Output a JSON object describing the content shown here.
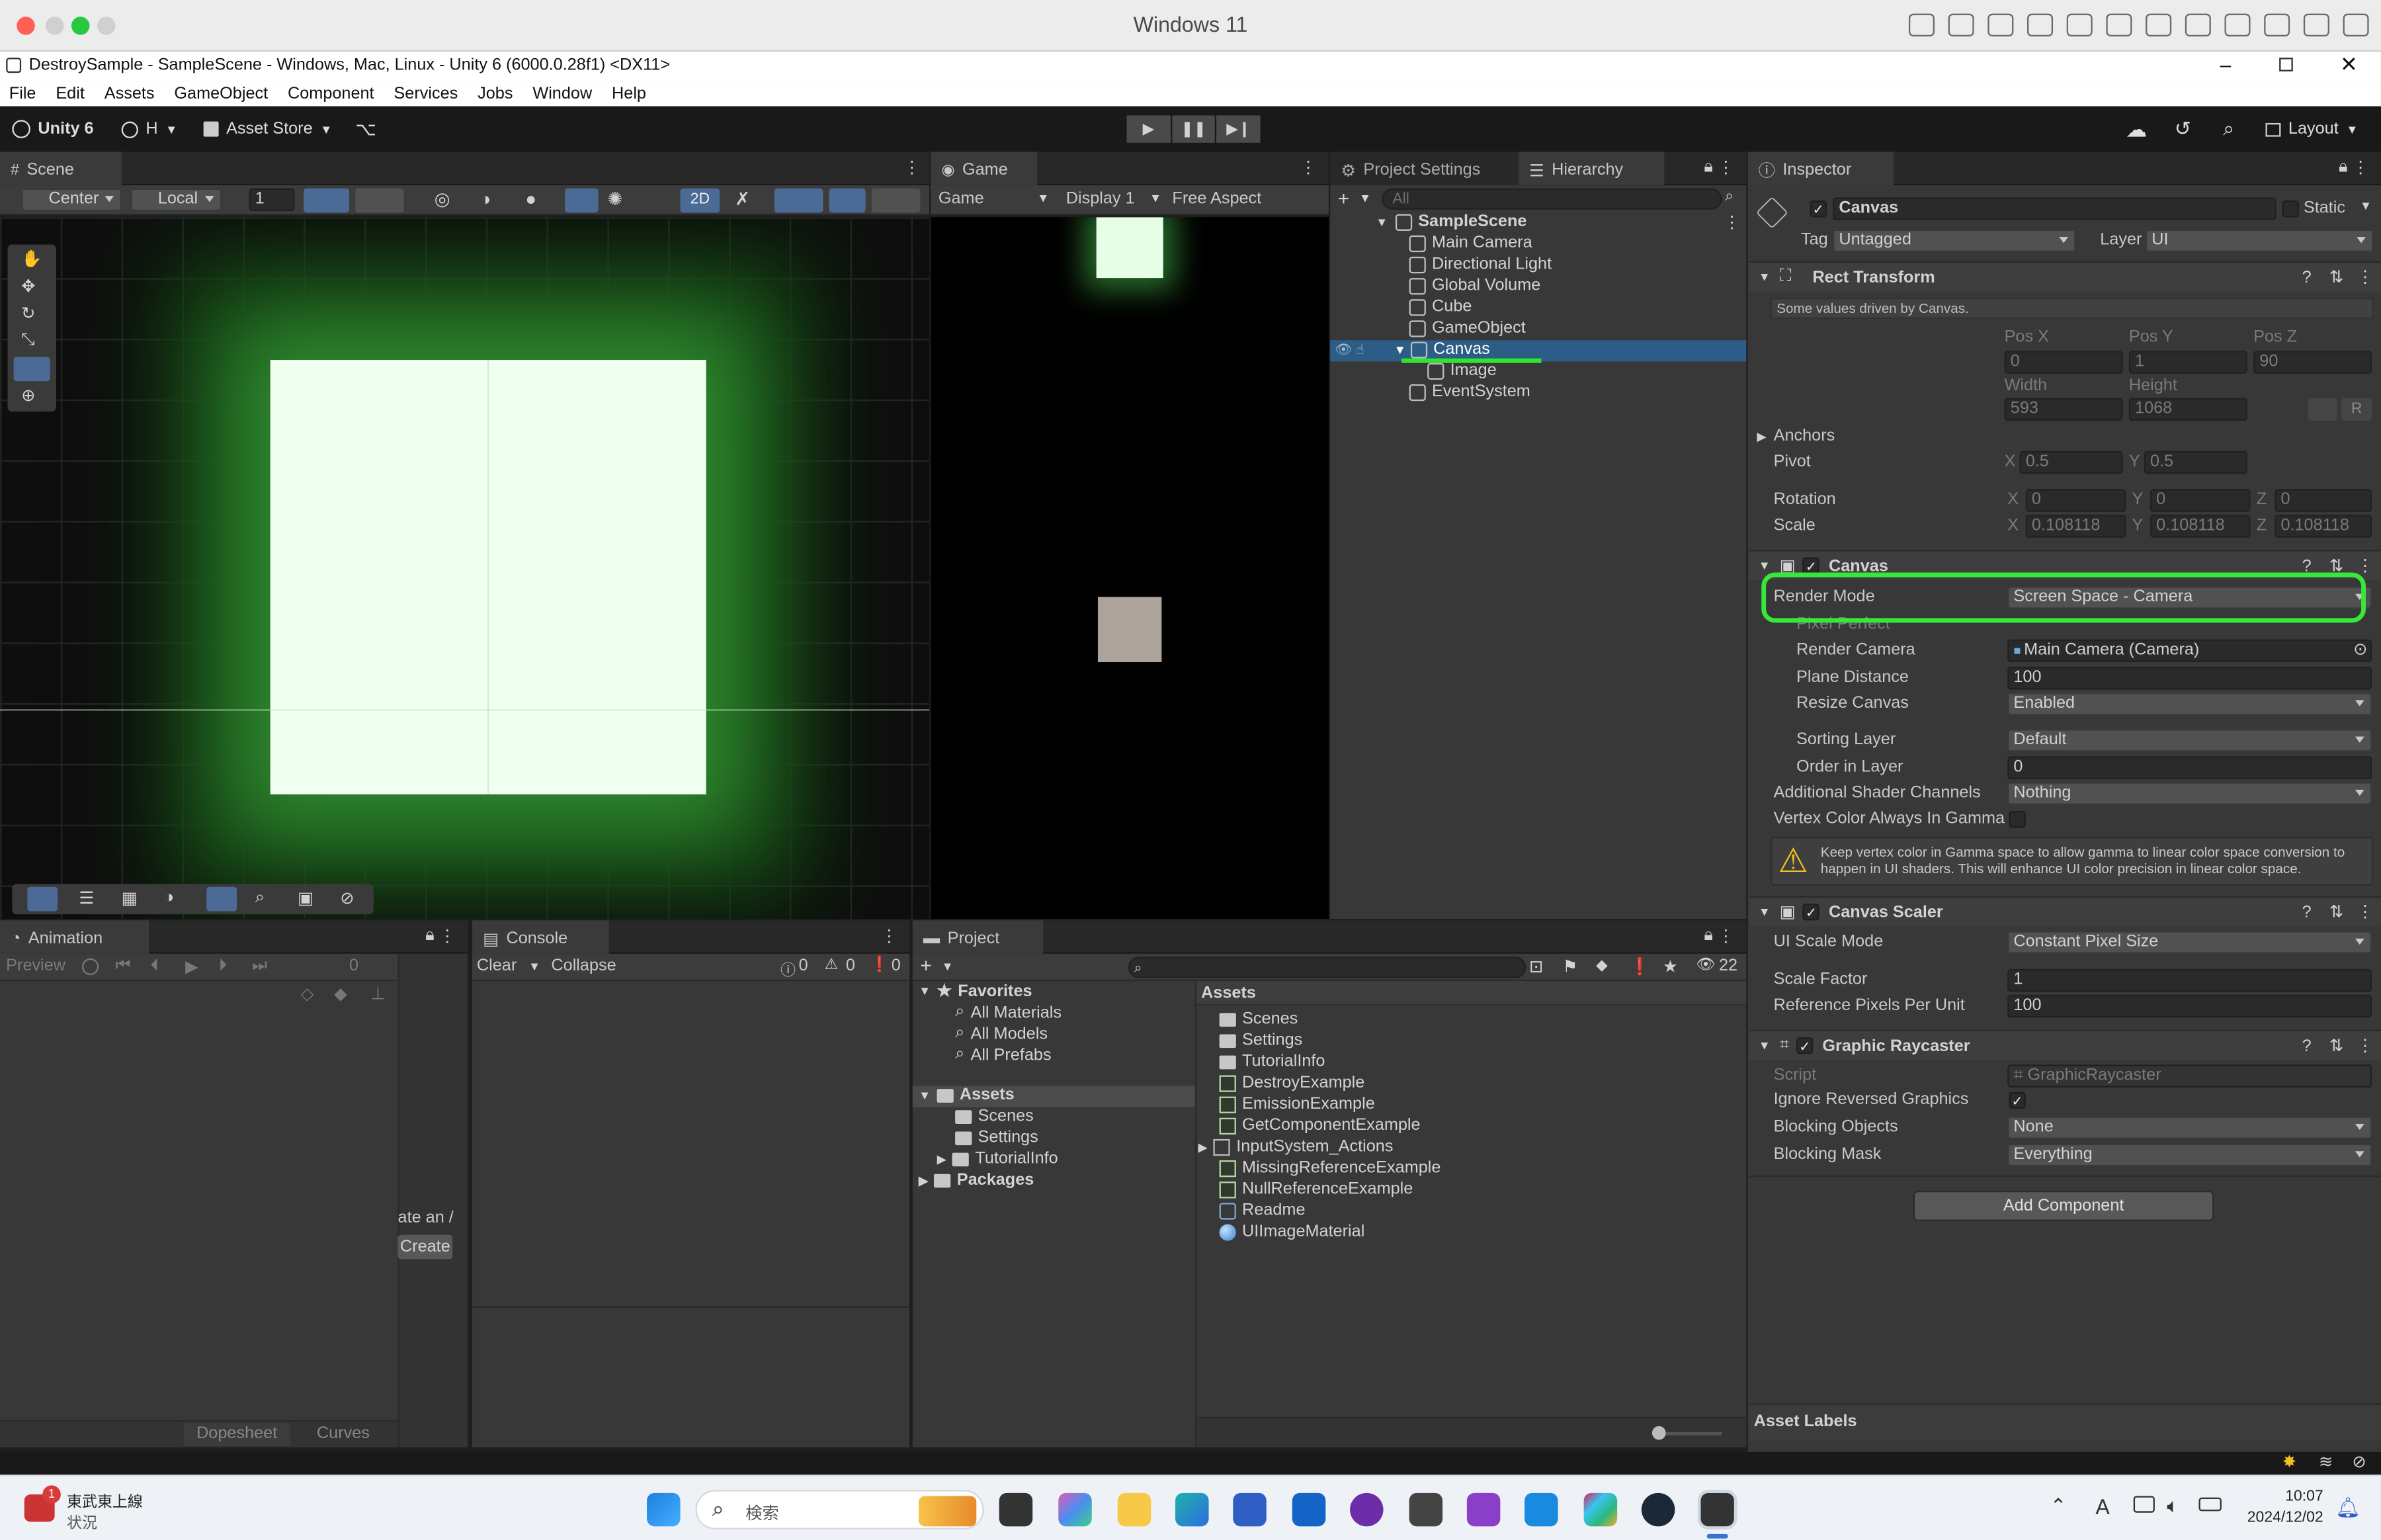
{
  "mac": {
    "title": "Windows 11"
  },
  "window": {
    "title": "DestroySample - SampleScene - Windows, Mac, Linux - Unity 6 (6000.0.28f1) <DX11>"
  },
  "menu": [
    "File",
    "Edit",
    "Assets",
    "GameObject",
    "Component",
    "Services",
    "Jobs",
    "Window",
    "Help"
  ],
  "toolbar": {
    "brand": "Unity 6",
    "account": "H",
    "asset_store": "Asset Store",
    "layout": "Layout"
  },
  "scene": {
    "tab": "Scene",
    "pivot": "Center",
    "space": "Local",
    "grid_value": "1",
    "mode2d": "2D"
  },
  "game": {
    "tab": "Game",
    "mode": "Game",
    "display": "Display 1",
    "aspect": "Free Aspect"
  },
  "hierarchy": {
    "tab_settings": "Project Settings",
    "tab": "Hierarchy",
    "search_placeholder": "All",
    "scene": "SampleScene",
    "items": [
      "Main Camera",
      "Directional Light",
      "Global Volume",
      "Cube",
      "GameObject",
      "Canvas",
      "Image",
      "EventSystem"
    ],
    "selected": "Canvas"
  },
  "inspector": {
    "tab": "Inspector",
    "object_name": "Canvas",
    "static_label": "Static",
    "tag_label": "Tag",
    "tag_value": "Untagged",
    "layer_label": "Layer",
    "layer_value": "UI",
    "rect": {
      "title": "Rect Transform",
      "note": "Some values driven by Canvas.",
      "posx_label": "Pos X",
      "posy_label": "Pos Y",
      "posz_label": "Pos Z",
      "posx": "0",
      "posy": "1",
      "posz": "90",
      "width_label": "Width",
      "height_label": "Height",
      "width": "593",
      "height": "1068",
      "r_btn": "R",
      "anchors": "Anchors",
      "pivot": "Pivot",
      "pivot_x": "0.5",
      "pivot_y": "0.5",
      "rotation": "Rotation",
      "rot_x": "0",
      "rot_y": "0",
      "rot_z": "0",
      "scale": "Scale",
      "scale_x": "0.108118",
      "scale_y": "0.108118",
      "scale_z": "0.108118",
      "x": "X",
      "y": "Y",
      "z": "Z"
    },
    "canvas": {
      "title": "Canvas",
      "render_mode_label": "Render Mode",
      "render_mode": "Screen Space - Camera",
      "pixel_perfect": "Pixel Perfect",
      "render_camera_label": "Render Camera",
      "render_camera": "Main Camera (Camera)",
      "plane_distance_label": "Plane Distance",
      "plane_distance": "100",
      "resize_label": "Resize Canvas",
      "resize": "Enabled",
      "sorting_layer_label": "Sorting Layer",
      "sorting_layer": "Default",
      "order_label": "Order in Layer",
      "order": "0",
      "shader_channels_label": "Additional Shader Channels",
      "shader_channels": "Nothing",
      "vertex_gamma_label": "Vertex Color Always In Gamma",
      "warning": "Keep vertex color in Gamma space to allow gamma to linear color space conversion to happen in UI shaders. This will enhance UI color precision in linear color space."
    },
    "scaler": {
      "title": "Canvas Scaler",
      "mode_label": "UI Scale Mode",
      "mode": "Constant Pixel Size",
      "factor_label": "Scale Factor",
      "factor": "1",
      "ppu_label": "Reference Pixels Per Unit",
      "ppu": "100"
    },
    "raycaster": {
      "title": "Graphic Raycaster",
      "script_label": "Script",
      "script": "GraphicRaycaster",
      "ignore_label": "Ignore Reversed Graphics",
      "blocking_label": "Blocking Objects",
      "blocking": "None",
      "mask_label": "Blocking Mask",
      "mask": "Everything"
    },
    "add_component": "Add Component",
    "asset_labels": "Asset Labels"
  },
  "animation": {
    "tab": "Animation",
    "preview": "Preview",
    "frame": "0",
    "cut_text": "ate an /",
    "create": "Create",
    "dopesheet": "Dopesheet",
    "curves": "Curves"
  },
  "console": {
    "tab": "Console",
    "clear": "Clear",
    "collapse": "Collapse",
    "counts": [
      "0",
      "0",
      "0"
    ]
  },
  "project": {
    "tab": "Project",
    "hidden_count": "22",
    "favorites": "Favorites",
    "fav_items": [
      "All Materials",
      "All Models",
      "All Prefabs"
    ],
    "assets": "Assets",
    "asset_folders": [
      "Scenes",
      "Settings",
      "TutorialInfo"
    ],
    "packages": "Packages",
    "right_title": "Assets",
    "right_items": [
      "Scenes",
      "Settings",
      "TutorialInfo",
      "DestroyExample",
      "EmissionExample",
      "GetComponentExample",
      "InputSystem_Actions",
      "MissingReferenceExample",
      "NullReferenceExample",
      "Readme",
      "UIImageMaterial"
    ]
  },
  "taskbar": {
    "weather_title": "東武東上線",
    "weather_sub": "状況",
    "badge": "1",
    "search": "検索",
    "time": "10:07",
    "date": "2024/12/02",
    "ime": "A"
  }
}
